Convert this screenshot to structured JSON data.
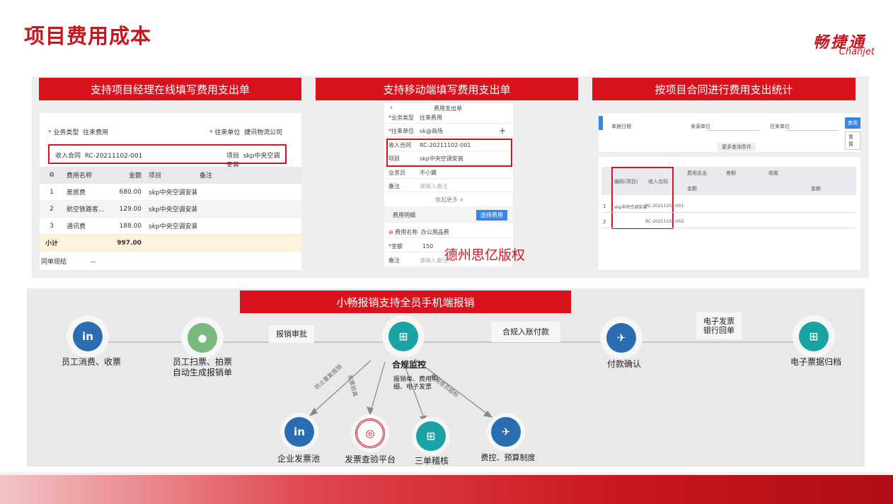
{
  "title": "项目费用成本",
  "logo": {
    "cn": "畅捷通",
    "en": "Chanjet"
  },
  "headers": [
    "支持项目经理在线填写费用支出单",
    "支持移动端填写费用支出单",
    "按项目合同进行费用支出统计"
  ],
  "shot1": {
    "biz_type_label": "业务类型",
    "biz_type_value": "往来费用",
    "party_label": "往来单位",
    "party_value": "捷讯物流公司",
    "contract_label": "收入合同",
    "contract_value": "RC-20211102-001",
    "project_label": "项目",
    "project_value": "skp中央空调安装",
    "columns": [
      "费用名称",
      "金额",
      "项目",
      "备注"
    ],
    "rows": [
      {
        "no": "1",
        "name": "差旅费",
        "amount": "680.00",
        "project": "skp中央空调安装"
      },
      {
        "no": "2",
        "name": "航空铁路客...",
        "amount": "129.00",
        "project": "skp中央空调安装"
      },
      {
        "no": "3",
        "name": "通讯费",
        "amount": "188.00",
        "project": "skp中央空调安装"
      }
    ],
    "subtotal_label": "小计",
    "subtotal_value": "997.00",
    "footer_label": "同单现结",
    "footer_value": "--"
  },
  "shot2": {
    "nav_title": "费用支出单",
    "rows": [
      {
        "label": "业务类型",
        "value": "往来费用"
      },
      {
        "label": "往来单位",
        "value": "sk@商场"
      },
      {
        "label": "收入合同",
        "value": "RC-20211102-001"
      },
      {
        "label": "项目",
        "value": "skp中央空调安装"
      },
      {
        "label": "业务员",
        "value": "不小翼"
      },
      {
        "label": "备注",
        "value": "请输入备注"
      }
    ],
    "collapse": "收起更多 ∧",
    "detail_label": "费用明细",
    "choose_btn": "选择费用",
    "item_name_label": "费用名称",
    "item_name_value": "办公用品费",
    "amount_label": "金额",
    "amount_value": "150",
    "note_label": "备注",
    "note_value": "请输入备注"
  },
  "watermark": "德州思亿版权",
  "shot3": {
    "filter1": "单据日期",
    "filter2": "来源单位",
    "filter3": "往来单位",
    "btn1": "查询",
    "btn2": "重置",
    "more": "更多查询条件",
    "th": [
      "编码(项目)",
      "收入合同",
      "费用支出",
      "差额",
      "收款",
      "金额",
      "金额"
    ],
    "rows": [
      {
        "no": "1",
        "a": "skp中央空调安装",
        "b": "RC-20211102-001"
      },
      {
        "no": "2",
        "a": "",
        "b": "RC-20211102-002"
      }
    ]
  },
  "flow": {
    "header": "小畅报销支持全员手机端报销",
    "nodes": [
      "员工消费、收票",
      "员工扫票、拍票\n自动生成报销单",
      "合规监控",
      "付款确认",
      "电子票据归档"
    ],
    "tags": [
      "报销审批",
      "合规入账付款",
      "电子发票\n银行回单"
    ],
    "sub": [
      "企业发票池",
      "发票查验平台",
      "三单稽核",
      "费控、预算制度"
    ],
    "arrows": [
      "防止重复报销",
      "发票验真",
      "报销单、费用明细、电子发票",
      "费用是否超标"
    ]
  },
  "colors": {
    "accent": "#d9131e",
    "brand": "#c8161e"
  }
}
